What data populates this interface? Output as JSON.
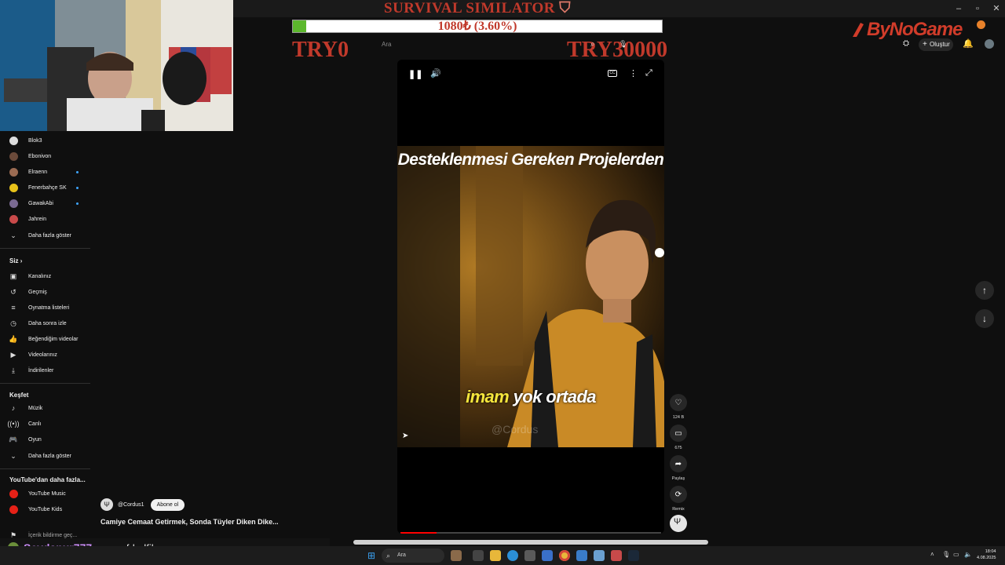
{
  "overlay": {
    "title": "SURVIVAL SIMILATOR",
    "goal_text": "1080₺ (3.60%)",
    "goal_fraction": 0.036,
    "goal_start": "TRY0",
    "goal_end": "TRY30000",
    "brand": "ByNoGame"
  },
  "header": {
    "search_placeholder": "Ara",
    "create_label": "Oluştur"
  },
  "sidebar": {
    "subscriptions": [
      {
        "label": "Blok3",
        "color": "#dddddd",
        "dot": false
      },
      {
        "label": "Ebonivon",
        "color": "#6b4a3a",
        "dot": false
      },
      {
        "label": "Elraenn",
        "color": "#9b6b52",
        "dot": true
      },
      {
        "label": "Fenerbahçe SK",
        "color": "#e8c21a",
        "dot": true
      },
      {
        "label": "GawakAbi",
        "color": "#7a6a92",
        "dot": true
      },
      {
        "label": "Jahrein",
        "color": "#c94a4a",
        "dot": false
      }
    ],
    "show_more": "Daha fazla göster",
    "you_heading": "Siz",
    "you_items": [
      {
        "label": "Kanalınız",
        "icon": "channel-icon",
        "glyph": "▣"
      },
      {
        "label": "Geçmiş",
        "icon": "history-icon",
        "glyph": "↺"
      },
      {
        "label": "Oynatma listeleri",
        "icon": "playlist-icon",
        "glyph": "≡"
      },
      {
        "label": "Daha sonra izle",
        "icon": "clock-icon",
        "glyph": "◷"
      },
      {
        "label": "Beğendiğim videolar",
        "icon": "thumbs-up-icon",
        "glyph": "👍"
      },
      {
        "label": "Videolarınız",
        "icon": "video-icon",
        "glyph": "▶"
      },
      {
        "label": "İndirilenler",
        "icon": "download-icon",
        "glyph": "⤓"
      }
    ],
    "explore_heading": "Keşfet",
    "explore_items": [
      {
        "label": "Müzik",
        "icon": "music-icon",
        "glyph": "♪"
      },
      {
        "label": "Canlı",
        "icon": "live-icon",
        "glyph": "((•))"
      },
      {
        "label": "Oyun",
        "icon": "gaming-icon",
        "glyph": "🎮"
      }
    ],
    "show_more_2": "Daha fazla göster",
    "more_heading": "YouTube'dan daha fazla...",
    "more_items": [
      {
        "label": "YouTube Music",
        "icon": "youtube-music-icon"
      },
      {
        "label": "YouTube Kids",
        "icon": "youtube-kids-icon"
      }
    ],
    "footer_cut": "İçerik bildirme geç..."
  },
  "video": {
    "caption_top": "Desteklenmesi Gereken Projelerden",
    "caption_highlight": "imam",
    "caption_rest": "yok ortada",
    "watermark": "@Cordus",
    "progress": 0.14
  },
  "actions": [
    {
      "name": "like",
      "icon": "heart-icon",
      "glyph": "♡",
      "label": "124 B"
    },
    {
      "name": "comments",
      "icon": "comment-icon",
      "glyph": "▭",
      "label": "675"
    },
    {
      "name": "share",
      "icon": "share-icon",
      "glyph": "➦",
      "label": "Paylaş"
    },
    {
      "name": "remix",
      "icon": "remix-icon",
      "glyph": "⟳",
      "label": "Remix"
    }
  ],
  "channel": {
    "handle": "@Cordus1",
    "subscribe": "Abone ol",
    "video_title": "Camiye Cemaat Getirmek, Sonda Tüyler Diken Dike..."
  },
  "chat": {
    "user": "Seydanur777",
    "message": "· yaaa fdgdfjkgn"
  },
  "taskbar": {
    "search": "Ara",
    "time": "18:04",
    "date": "4.08.2025"
  }
}
